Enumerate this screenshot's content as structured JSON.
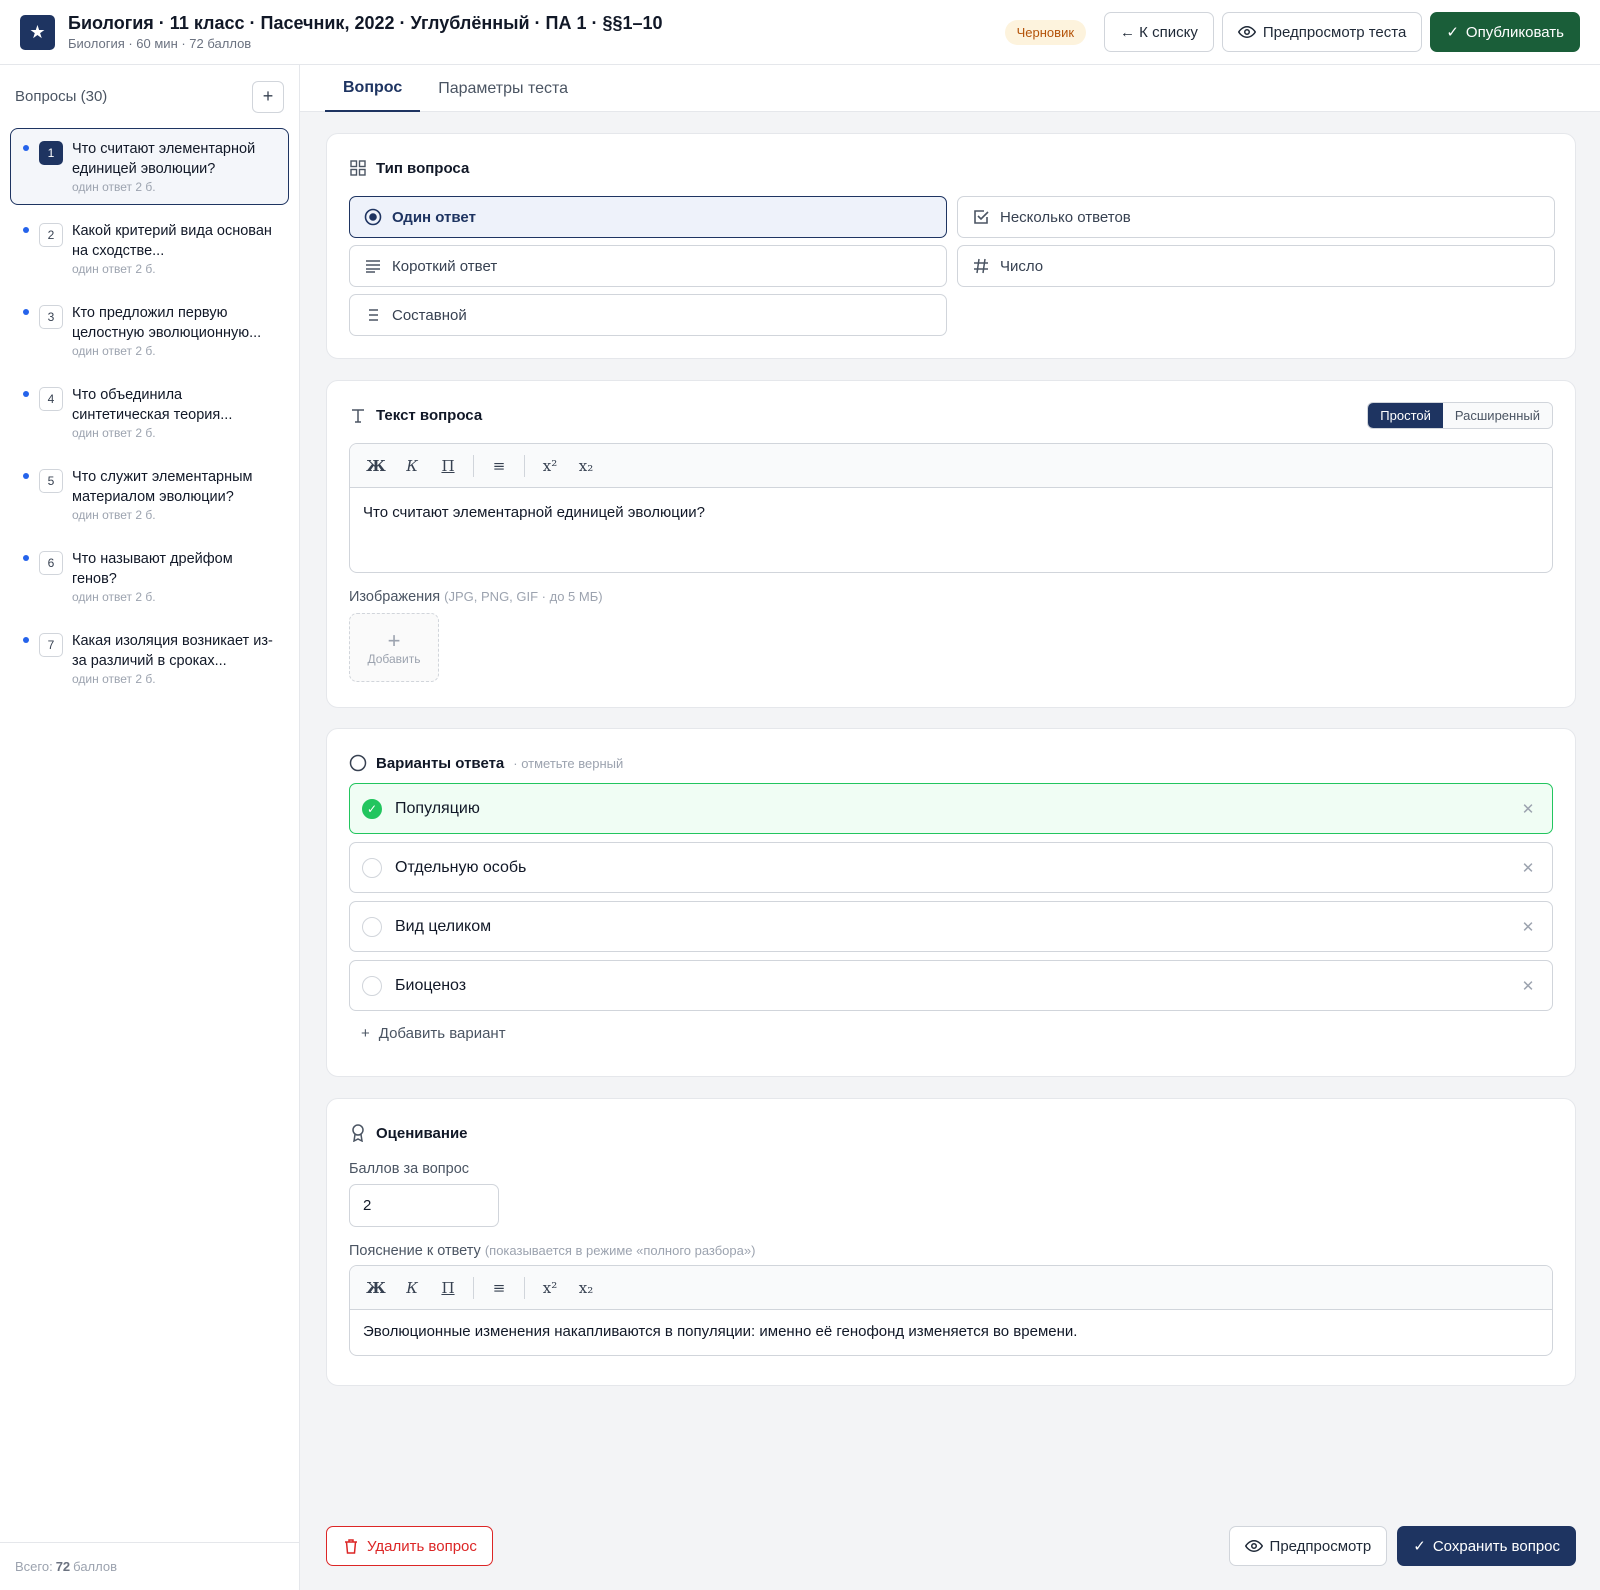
{
  "header": {
    "logo_icon": "star-icon",
    "title": "Биология · 11 класс · Пасечник, 2022 · Углублённый · ПА 1 · §§1–10",
    "subtitle": "Биология · 60 мин · 72 баллов",
    "status_badge": "Черновик",
    "back_label": "← К списку",
    "preview_test_label": "Предпросмотр теста",
    "publish_label": "Опубликовать"
  },
  "sidebar": {
    "title": "Вопросы (30)",
    "add_label": "+",
    "items": [
      {
        "num": "1",
        "text": "Что считают элементарной единицей эволюции?",
        "meta": "один ответ   2 б."
      },
      {
        "num": "2",
        "text": "Какой критерий вида основан на сходстве...",
        "meta": "один ответ   2 б."
      },
      {
        "num": "3",
        "text": "Кто предложил первую целостную эволюционную...",
        "meta": "один ответ   2 б."
      },
      {
        "num": "4",
        "text": "Что объединила синтетическая теория...",
        "meta": "один ответ   2 б."
      },
      {
        "num": "5",
        "text": "Что служит элементарным материалом эволюции?",
        "meta": "один ответ   2 б."
      },
      {
        "num": "6",
        "text": "Что называют дрейфом генов?",
        "meta": "один ответ   2 б."
      },
      {
        "num": "7",
        "text": "Какая изоляция возникает из-за различий в сроках...",
        "meta": "один ответ   2 б."
      }
    ],
    "footer_prefix": "Всего:",
    "footer_total": "72",
    "footer_suffix": "баллов"
  },
  "tabs": [
    {
      "label": "Вопрос",
      "active": true
    },
    {
      "label": "Параметры теста",
      "active": false
    }
  ],
  "question_type": {
    "title": "Тип вопроса",
    "options": [
      {
        "label": "Один ответ",
        "icon": "radio-target-icon"
      },
      {
        "label": "Несколько ответов",
        "icon": "checkbox-icon"
      },
      {
        "label": "Короткий ответ",
        "icon": "lines-icon"
      },
      {
        "label": "Число",
        "icon": "hash-icon"
      },
      {
        "label": "Составной",
        "icon": "list-icon"
      }
    ],
    "selected": "Один ответ"
  },
  "question_text": {
    "title": "Текст вопроса",
    "mode_simple": "Простой",
    "mode_extended": "Расширенный",
    "toolbar": {
      "bold": "Ж",
      "italic": "К",
      "underline": "П",
      "list": "≡",
      "sup": "x²",
      "sub": "x₂"
    },
    "content": "Что считают элементарной единицей эволюции?",
    "images_label": "Изображения",
    "images_hint": "(JPG, PNG, GIF · до 5 МБ)",
    "add_image": "Добавить"
  },
  "answers": {
    "title": "Варианты ответа",
    "hint": "· отметьте верный",
    "items": [
      {
        "text": "Популяцию",
        "correct": true
      },
      {
        "text": "Отдельную особь",
        "correct": false
      },
      {
        "text": "Вид целиком",
        "correct": false
      },
      {
        "text": "Биоценоз",
        "correct": false
      }
    ],
    "add_label": "Добавить вариант"
  },
  "grading": {
    "title": "Оценивание",
    "points_label": "Баллов за вопрос",
    "points_value": "2",
    "explanation_label": "Пояснение к ответу",
    "explanation_hint": "(показывается в режиме «полного разбора»)",
    "explanation": "Эволюционные изменения накапливаются в популяции: именно её генофонд изменяется во времени."
  },
  "footer": {
    "delete_label": "Удалить вопрос",
    "preview_label": "Предпросмотр",
    "save_label": "Сохранить вопрос"
  },
  "colors": {
    "brand": "#1e3461",
    "publish": "#1a5e39",
    "correct": "#22c55e",
    "danger": "#dc2626"
  }
}
